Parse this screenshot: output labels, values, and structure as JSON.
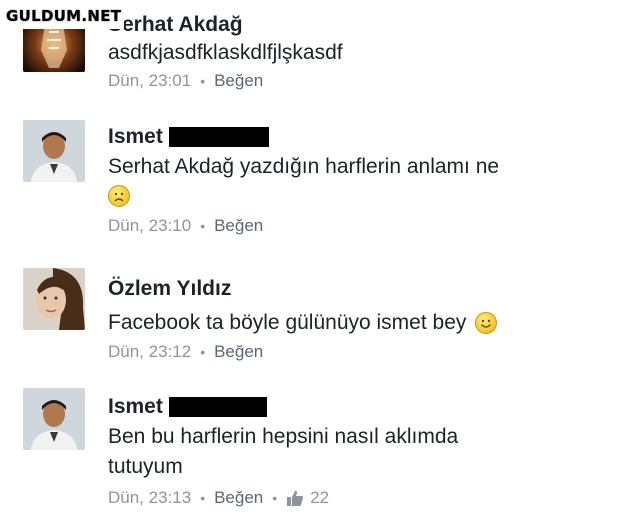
{
  "watermark": "GULDUM.NET",
  "comments": [
    {
      "name": "Serhat Akdağ",
      "text": "asdfkjasdfklaskdlfjlşkasdf",
      "time": "Dün, 23:01",
      "like": "Beğen"
    },
    {
      "name": "Ismet",
      "text": "Serhat Akdağ yazdığın harflerin anlamı ne",
      "emoji": "sad-face-icon",
      "time": "Dün, 23:10",
      "like": "Beğen"
    },
    {
      "name": "Özlem Yıldız",
      "text": "Facebook ta böyle gülünüyo ismet bey",
      "emoji": "smiley-face-icon",
      "time": "Dün, 23:12",
      "like": "Beğen"
    },
    {
      "name": "Ismet",
      "text": "Ben bu harflerin hepsini nasıl aklımda",
      "text2": "tutuyum",
      "time": "Dün, 23:13",
      "like": "Beğen",
      "like_count": "22"
    }
  ]
}
